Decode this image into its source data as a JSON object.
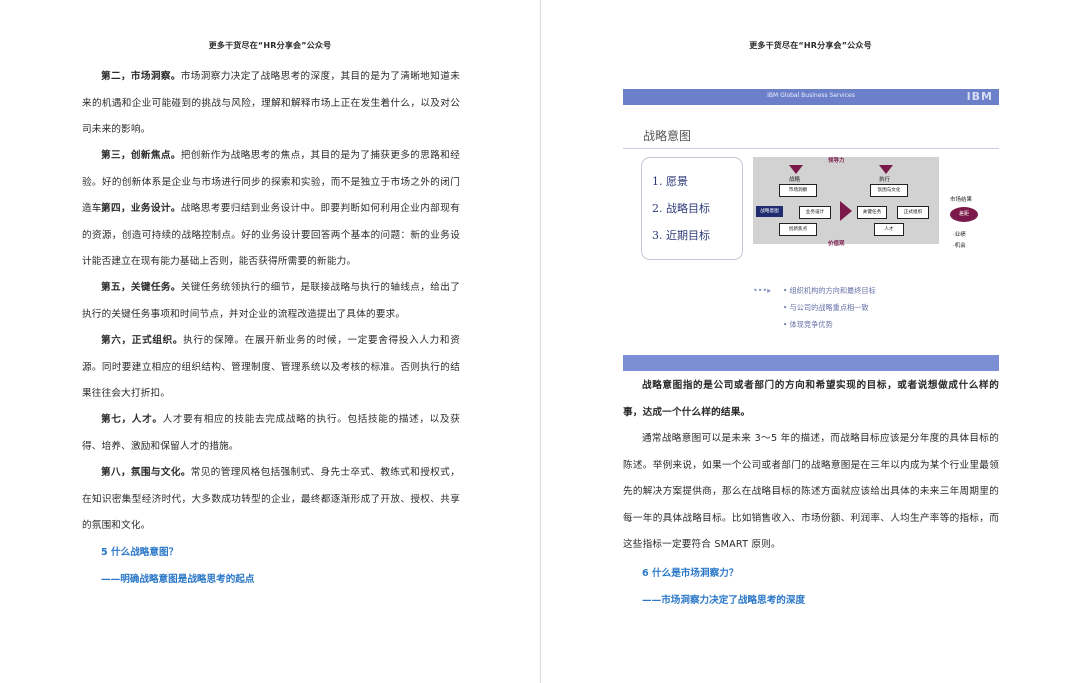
{
  "header": "更多干货尽在“HR分享会”公众号",
  "left": {
    "paragraphs": [
      {
        "lead": "第二，市场洞察。",
        "text": "市场洞察力决定了战略思考的深度，其目的是为了清晰地知道未来的机遇和企业可能碰到的挑战与风险，理解和解释市场上正在发生着什么，以及对公司未来的影响。"
      },
      {
        "lead": "第三，创新焦点。",
        "text": "把创新作为战略思考的焦点，其目的是为了捕获更多的思路和经验。好的创新体系是企业与市场进行同步的探索和实验，而不是独立于市场之外的闭门造车。"
      },
      {
        "lead": "第四，业务设计。",
        "text": "战略思考要归结到业务设计中。即要判断如何利用企业内部现有的资源，创造可持续的战略控制点。好的业务设计要回答两个基本的问题：新的业务设计能否建立在现有能力基础上否则，能否获得所需要的新能力。"
      },
      {
        "lead": "第五，关键任务。",
        "text": "关键任务统领执行的细节，是联接战略与执行的轴线点，给出了执行的关键任务事项和时间节点，并对企业的流程改造提出了具体的要求。"
      },
      {
        "lead": "第六，正式组织。",
        "text": "执行的保障。在展开新业务的时候，一定要舍得投入人力和资源。同时要建立相应的组织结构、管理制度、管理系统以及考核的标准。否则执行的结果往往会大打折扣。"
      },
      {
        "lead": "第七，人才。",
        "text": "人才要有相应的技能去完成战略的执行。包括技能的描述，以及获得、培养、激励和保留人才的措施。"
      },
      {
        "lead": "第八，氛围与文化。",
        "text": "常见的管理风格包括强制式、身先士卒式、教练式和授权式，在知识密集型经济时代，大多数成功转型的企业，最终都逐渐形成了开放、授权、共享的氛围和文化。"
      }
    ],
    "section_title": "5 什么战略意图？",
    "section_subtitle": "——明确战略意图是战略思考的起点"
  },
  "slide": {
    "banner": "IBM Global Business Services",
    "logo": "IBM",
    "title": "战略意图",
    "list": [
      "1. 愿景",
      "2. 战略目标",
      "3. 近期目标"
    ],
    "top_label": "领导力",
    "bottom_label": "价值观",
    "col1_label": "战略",
    "col2_label": "执行",
    "boxes": {
      "market": "市场洞察",
      "intent": "战略意图",
      "design": "业务设计",
      "innovation": "创新焦点",
      "culture": "氛围与文化",
      "task": "关键任务",
      "org": "正式组织",
      "talent": "人才"
    },
    "result_title": "市场结果",
    "gap": "差距",
    "side_text_1": "·业绩",
    "side_text_2": "·机会",
    "bullets": [
      "组织机构的方向和最终目标",
      "与公司的战略重点相一致",
      "体现竞争优势"
    ]
  },
  "right": {
    "bold_paragraph": "战略意图指的是公司或者部门的方向和希望实现的目标，或者说想做成什么样的事，达成一个什么样的结果。",
    "para1": "通常战略意图可以是未来 3～5 年的描述，而战略目标应该是分年度的具体目标的陈述。举例来说，如果一个公司或者部门的战略意图是在三年以内成为某个行业里最领先的解决方案提供商，那么在战略目标的陈述方面就应该给出具体的未来三年周期里的每一年的具体战略目标。比如销售收入、市场份额、利润率、人均生产率等的指标，而这些指标一定要符合 SMART 原则。",
    "section_title": "6 什么是市场洞察力？",
    "section_subtitle": "——市场洞察力决定了战略思考的深度"
  }
}
